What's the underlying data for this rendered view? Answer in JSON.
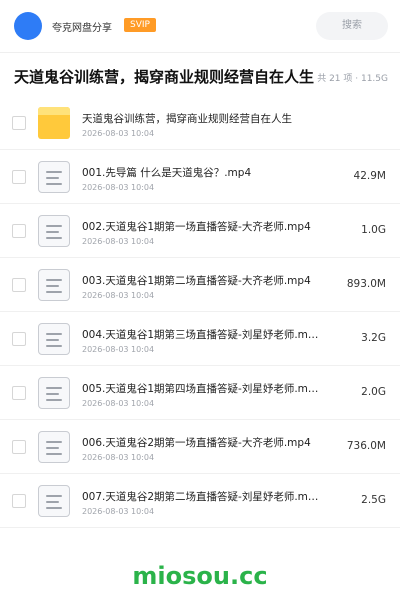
{
  "header": {
    "share_name": "夸克网盘分享",
    "badge": "SVIP",
    "search_label": "搜索",
    "avatar_color": "#2e7cf6",
    "badge_color": "#ff9b26"
  },
  "page": {
    "title": "天道鬼谷训练营，揭穿商业规则经营自在人生",
    "meta": "共 21 项 · 11.5G"
  },
  "files": [
    {
      "icon": "folder-icon",
      "name": "天道鬼谷训练营，揭穿商业规则经营自在人生",
      "date": "2026-08-03 10:04",
      "size": ""
    },
    {
      "icon": "document-icon",
      "name": "001.先导篇 什么是天道鬼谷？.mp4",
      "date": "2026-08-03 10:04",
      "size": "42.9M"
    },
    {
      "icon": "document-icon",
      "name": "002.天道鬼谷1期第一场直播答疑-大齐老师.mp4",
      "date": "2026-08-03 10:04",
      "size": "1.0G"
    },
    {
      "icon": "document-icon",
      "name": "003.天道鬼谷1期第二场直播答疑-大齐老师.mp4",
      "date": "2026-08-03 10:04",
      "size": "893.0M"
    },
    {
      "icon": "document-icon",
      "name": "004.天道鬼谷1期第三场直播答疑-刘星妤老师.m…",
      "date": "2026-08-03 10:04",
      "size": "3.2G"
    },
    {
      "icon": "document-icon",
      "name": "005.天道鬼谷1期第四场直播答疑-刘星妤老师.m…",
      "date": "2026-08-03 10:04",
      "size": "2.0G"
    },
    {
      "icon": "document-icon",
      "name": "006.天道鬼谷2期第一场直播答疑-大齐老师.mp4",
      "date": "2026-08-03 10:04",
      "size": "736.0M"
    },
    {
      "icon": "document-icon",
      "name": "007.天道鬼谷2期第二场直播答疑-刘星妤老师.m…",
      "date": "2026-08-03 10:04",
      "size": "2.5G"
    }
  ],
  "watermark": {
    "text": "miosou.cc",
    "color": "#2bb34a"
  }
}
